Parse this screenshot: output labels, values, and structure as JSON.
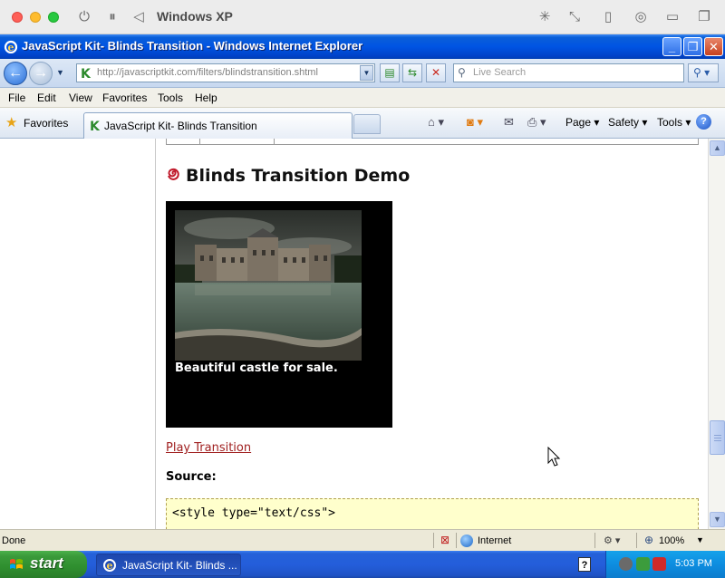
{
  "host": {
    "title": "Windows XP"
  },
  "window": {
    "title": "JavaScript Kit- Blinds Transition - Windows Internet Explorer",
    "controls": {
      "minimize": "_",
      "maximize": "❐",
      "close": "✕"
    }
  },
  "address": {
    "url": "http://javascriptkit.com/filters/blindstransition.shtml",
    "search_placeholder": "Live Search"
  },
  "menu": {
    "items": [
      "File",
      "Edit",
      "View",
      "Favorites",
      "Tools",
      "Help"
    ]
  },
  "tabs": {
    "favorites_label": "Favorites",
    "active_tab_label": "JavaScript Kit- Blinds Transition",
    "commands": {
      "page": "Page ▾",
      "safety": "Safety ▾",
      "tools": "Tools ▾",
      "help": "?"
    }
  },
  "content": {
    "heading": "Blinds Transition Demo",
    "caption": "Beautiful castle for sale.",
    "play_link": "Play Transition",
    "source_label": "Source:",
    "code_line": "<style type=\"text/css\">"
  },
  "status": {
    "text": "Done",
    "zone": "Internet",
    "zoom": "100%"
  },
  "taskbar": {
    "start_label": "start",
    "task_label": "JavaScript Kit- Blinds ...",
    "clock": "5:03 PM"
  },
  "colors": {
    "xp_blue": "#0054e3",
    "start_green": "#3a9a3a",
    "link_red": "#a02020",
    "code_bg": "#ffffcc"
  }
}
